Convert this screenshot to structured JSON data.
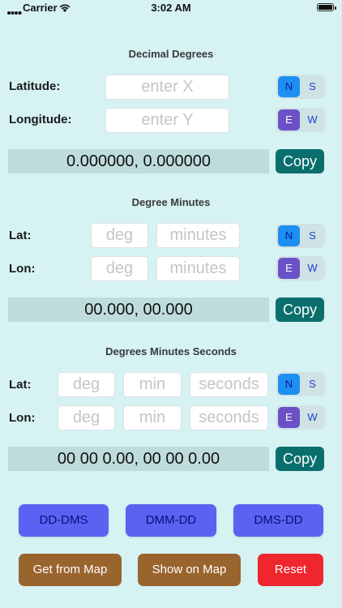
{
  "status_bar": {
    "carrier": "Carrier",
    "time": "3:02 AM"
  },
  "decimal_degrees": {
    "title": "Decimal Degrees",
    "latitude_label": "Latitude:",
    "latitude_placeholder": "enter X",
    "longitude_label": "Longitude:",
    "longitude_placeholder": "enter Y",
    "ns": {
      "n": "N",
      "s": "S",
      "selected": "N"
    },
    "ew": {
      "e": "E",
      "w": "W",
      "selected": "E"
    },
    "result": "0.000000, 0.000000",
    "copy_label": "Copy"
  },
  "degree_minutes": {
    "title": "Degree Minutes",
    "lat_label": "Lat:",
    "lon_label": "Lon:",
    "deg_placeholder": "deg",
    "minutes_placeholder": "minutes",
    "ns": {
      "n": "N",
      "s": "S",
      "selected": "N"
    },
    "ew": {
      "e": "E",
      "w": "W",
      "selected": "E"
    },
    "result": "00.000, 00.000",
    "copy_label": "Copy"
  },
  "dms": {
    "title": "Degrees Minutes Seconds",
    "lat_label": "Lat:",
    "lon_label": "Lon:",
    "deg_placeholder": "deg",
    "min_placeholder": "min",
    "seconds_placeholder": "seconds",
    "ns": {
      "n": "N",
      "s": "S",
      "selected": "N"
    },
    "ew": {
      "e": "E",
      "w": "W",
      "selected": "E"
    },
    "result": "00 00 0.00, 00 00 0.00",
    "copy_label": "Copy"
  },
  "actions": {
    "dd_dms": "DD-DMS",
    "dmm_dd": "DMM-DD",
    "dms_dd": "DMS-DD",
    "get_from_map": "Get from Map",
    "show_on_map": "Show on Map",
    "reset": "Reset"
  },
  "colors": {
    "background": "#d6f2f3",
    "copy_button": "#0a6f6c",
    "convert_button": "#5a62f2",
    "map_button": "#9a642e",
    "reset_button": "#f0262e",
    "selected_ns": "#1d8ef2",
    "selected_ew": "#6a52c6"
  }
}
